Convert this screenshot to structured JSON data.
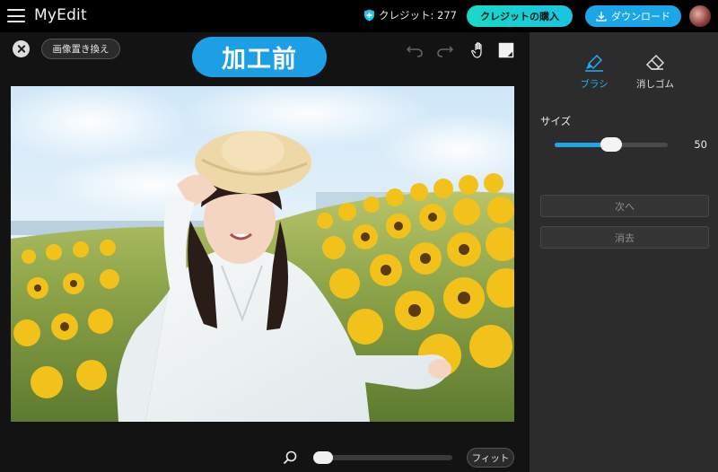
{
  "topbar": {
    "logo": "MyEdit",
    "credit_text": "クレジット: 277",
    "buy_label": "クレジットの購入",
    "download_label": "ダウンロード"
  },
  "work": {
    "replace_label": "画像置き換え",
    "badge_label": "加工前",
    "fit_label": "フィット",
    "zoom_level": 0.06
  },
  "panel": {
    "modes": [
      {
        "label": "ブラシ",
        "active": true,
        "icon": "brush-icon"
      },
      {
        "label": "消しゴム",
        "active": false,
        "icon": "eraser-icon"
      }
    ],
    "size_label": "サイズ",
    "size_value": "50",
    "size_fraction": 0.5,
    "next_label": "次へ",
    "clear_label": "消去"
  },
  "colors": {
    "accent": "#1d9fe6",
    "buy_gradient_start": "#1ad9c6",
    "panel_bg": "#2c2c2c",
    "topbar_bg": "#000000"
  }
}
